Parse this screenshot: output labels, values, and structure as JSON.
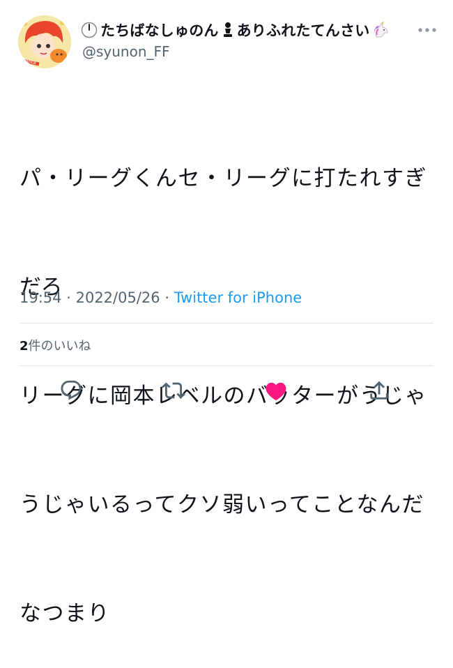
{
  "tweet": {
    "display_name": "たちばなしゅのん",
    "display_name_2": "ありふれたてんさい",
    "handle": "@syunon_FF",
    "text_lines": [
      "パ・リーグくんセ・リーグに打たれすぎ",
      "だろ",
      "リーグに岡本レベルのバッターがうじゃ",
      "うじゃいるってクソ弱いってことなんだ",
      "なつまり"
    ],
    "time": "19:54",
    "date": "2022/05/26",
    "separator": "·",
    "source": "Twitter for iPhone",
    "likes_count": "2",
    "likes_label": "件のいいね",
    "avatar_text": "Ponta"
  },
  "icons": {
    "reply": "reply-icon",
    "retweet": "retweet-icon",
    "like": "heart-icon",
    "share": "share-icon",
    "more": "more-dots-icon"
  },
  "colors": {
    "like_active": "#f91880",
    "link": "#1d9bf0",
    "secondary_text": "#536471"
  }
}
